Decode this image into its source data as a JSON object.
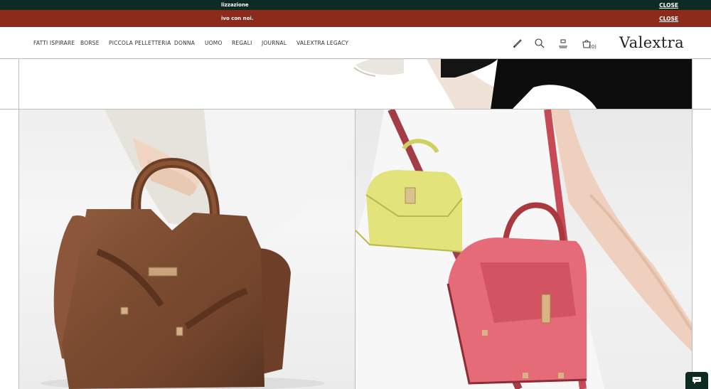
{
  "banners": [
    {
      "message": "lizzazione",
      "close_label": "CLOSE"
    },
    {
      "message": "ivo con noi.",
      "close_label": "CLOSE"
    }
  ],
  "nav": {
    "items": [
      {
        "label": "FATTI ISPIRARE"
      },
      {
        "label": "BORSE"
      },
      {
        "label": "PICCOLA PELLETTERIA"
      },
      {
        "label": "DONNA"
      },
      {
        "label": "UOMO"
      },
      {
        "label": "REGALI"
      },
      {
        "label": "JOURNAL"
      },
      {
        "label": "VALEXTRA LEGACY"
      }
    ]
  },
  "header_icons": [
    "phone-icon",
    "search-icon",
    "account-icon",
    "cart-icon"
  ],
  "cart": {
    "count": "(0)"
  },
  "brand": {
    "logo": "Valextra"
  },
  "colors": {
    "banner_dark_green": "#0d2b22",
    "banner_red": "#8c2a1c",
    "bag_brown": "#7a4a30",
    "bag_yellow": "#e2e37a",
    "bag_pink": "#e56b78"
  },
  "chat": {
    "icon": "chat-icon"
  }
}
